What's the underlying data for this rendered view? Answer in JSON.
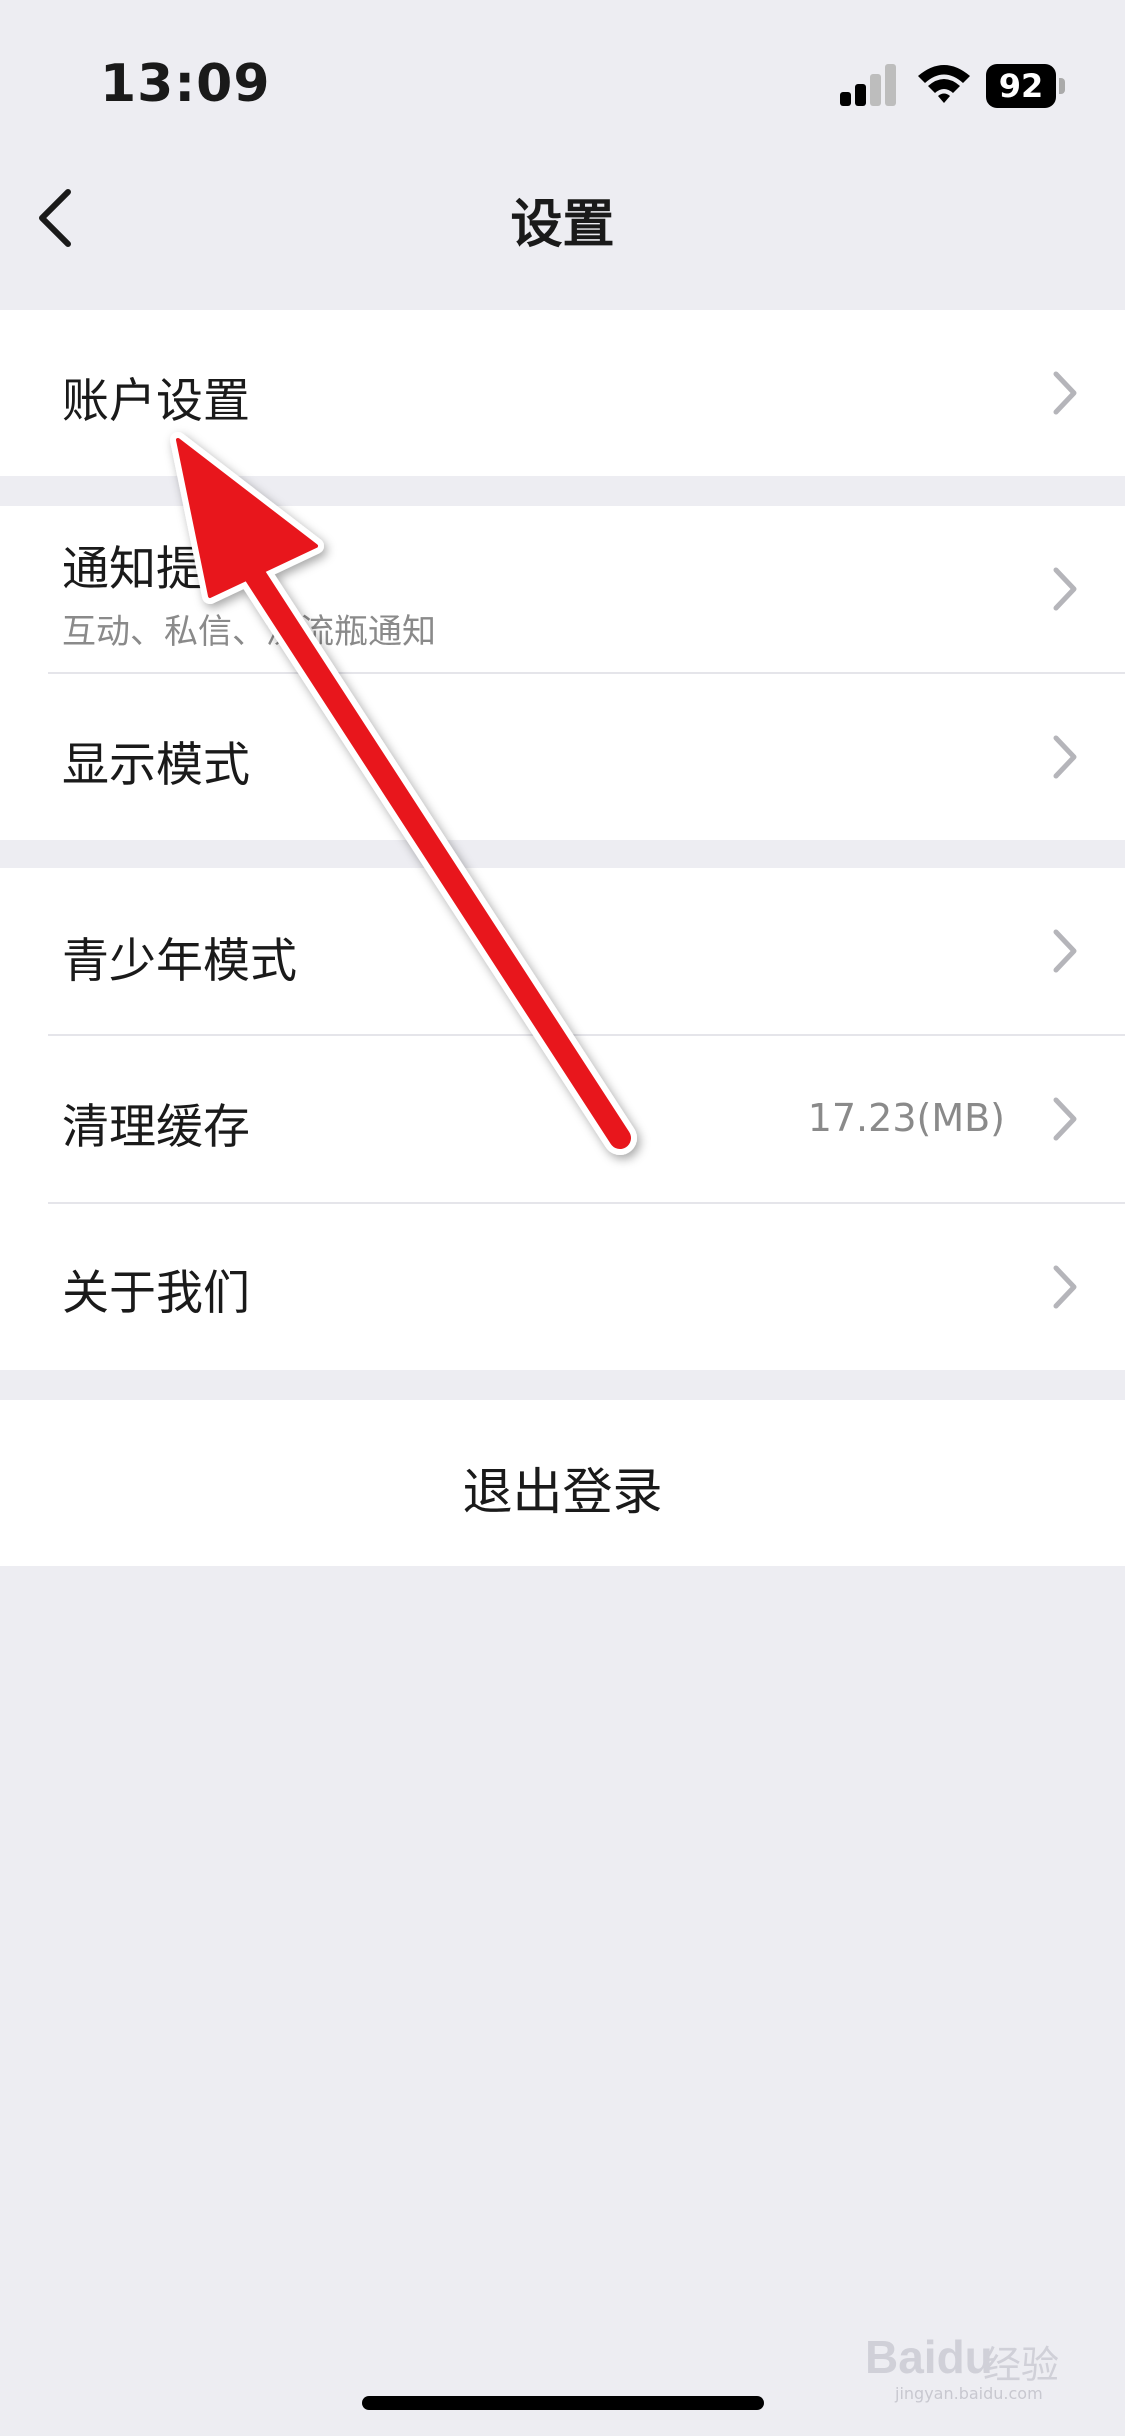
{
  "status_bar": {
    "time": "13:09",
    "battery": "92",
    "icons": [
      "signal-icon",
      "wifi-icon",
      "battery-icon"
    ]
  },
  "nav": {
    "title": "设置",
    "back_icon": "chevron-left-icon"
  },
  "groups": [
    {
      "items": [
        {
          "label": "账户设置",
          "sub": "",
          "value": ""
        }
      ]
    },
    {
      "items": [
        {
          "label": "通知提醒",
          "sub": "互动、私信、漂流瓶通知",
          "value": ""
        },
        {
          "label": "显示模式",
          "sub": "",
          "value": ""
        }
      ]
    },
    {
      "items": [
        {
          "label": "青少年模式",
          "sub": "",
          "value": ""
        },
        {
          "label": "清理缓存",
          "sub": "",
          "value": "17.23(MB)"
        },
        {
          "label": "关于我们",
          "sub": "",
          "value": ""
        }
      ]
    }
  ],
  "logout": {
    "label": "退出登录"
  },
  "annotation": {
    "type": "red-arrow",
    "points_to": "账户设置",
    "color": "#E8141C"
  },
  "watermark": {
    "brand": "Baidu",
    "cn": "经验",
    "url": "jingyan.baidu.com"
  },
  "colors": {
    "background": "#EDEDF2",
    "card": "#FFFFFF",
    "secondary_text": "#8A8A8A",
    "chevron": "#B5B5BA",
    "arrow": "#E8141C"
  }
}
